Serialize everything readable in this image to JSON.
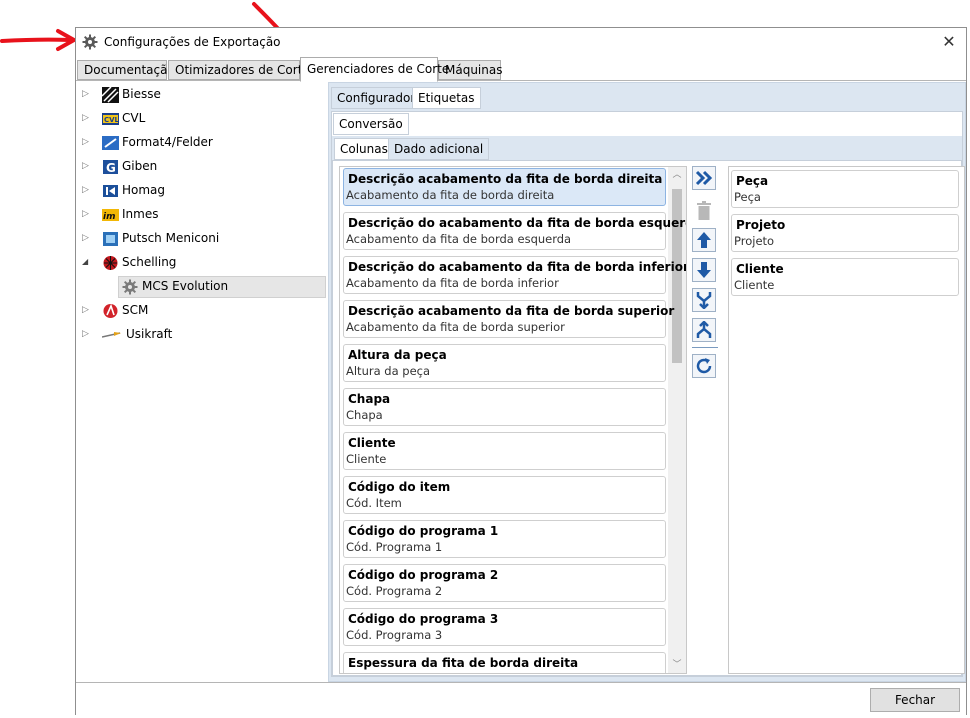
{
  "window": {
    "title": "Configurações de Exportação",
    "close_glyph": "✕",
    "icon": "gear-icon"
  },
  "main_tabs": [
    {
      "label": "Documentação",
      "active": false
    },
    {
      "label": "Otimizadores de Corte",
      "active": false
    },
    {
      "label": "Gerenciadores de Corte",
      "active": true
    },
    {
      "label": "Máquinas",
      "active": false
    }
  ],
  "tree": {
    "items": [
      {
        "label": "Biesse",
        "icon": "biesse-logo-icon",
        "expander": "▷"
      },
      {
        "label": "CVL",
        "icon": "cvl-logo-icon",
        "expander": "▷"
      },
      {
        "label": "Format4/Felder",
        "icon": "format4-logo-icon",
        "expander": "▷"
      },
      {
        "label": "Giben",
        "icon": "giben-logo-icon",
        "expander": "▷"
      },
      {
        "label": "Homag",
        "icon": "homag-logo-icon",
        "expander": "▷"
      },
      {
        "label": "Inmes",
        "icon": "inmes-logo-icon",
        "expander": "▷"
      },
      {
        "label": "Putsch Meniconi",
        "icon": "putsch-logo-icon",
        "expander": "▷"
      },
      {
        "label": "Schelling",
        "icon": "schelling-logo-icon",
        "expander": "◢"
      },
      {
        "label": "MCS Evolution",
        "icon": "gear-icon",
        "expander": ""
      },
      {
        "label": "SCM",
        "icon": "scm-logo-icon",
        "expander": "▷"
      },
      {
        "label": "Usikraft",
        "icon": "usikraft-logo-icon",
        "expander": "▷"
      }
    ]
  },
  "sub_tabs": {
    "level1": [
      {
        "label": "Configurador",
        "active": false
      },
      {
        "label": "Etiquetas",
        "active": true
      }
    ],
    "level2": [
      {
        "label": "Conversão",
        "active": true
      }
    ],
    "level3": [
      {
        "label": "Colunas",
        "active": true
      },
      {
        "label": "Dado adicional",
        "active": false
      }
    ]
  },
  "available_columns": [
    {
      "title": "Descrição acabamento da fita de borda direita",
      "sub": "Acabamento da fita de borda direita"
    },
    {
      "title": "Descrição do acabamento da fita de borda esquerda",
      "sub": "Acabamento da fita de borda esquerda"
    },
    {
      "title": "Descrição do acabamento da fita de borda inferior",
      "sub": "Acabamento da fita de borda inferior"
    },
    {
      "title": "Descrição acabamento da fita de borda superior",
      "sub": "Acabamento da fita de borda superior"
    },
    {
      "title": "Altura da peça",
      "sub": "Altura da peça"
    },
    {
      "title": "Chapa",
      "sub": "Chapa"
    },
    {
      "title": "Cliente",
      "sub": "Cliente"
    },
    {
      "title": "Código do item",
      "sub": "Cód. Item"
    },
    {
      "title": "Código do programa 1",
      "sub": "Cód. Programa 1"
    },
    {
      "title": "Código do programa 2",
      "sub": "Cód. Programa 2"
    },
    {
      "title": "Código do programa 3",
      "sub": "Cód. Programa 3"
    },
    {
      "title": "Espessura da fita de borda direita",
      "sub": ""
    }
  ],
  "selected_columns": [
    {
      "title": "Peça",
      "sub": "Peça"
    },
    {
      "title": "Projeto",
      "sub": "Projeto"
    },
    {
      "title": "Cliente",
      "sub": "Cliente"
    }
  ],
  "toolbar": {
    "buttons": [
      "add-all-icon",
      "delete-icon",
      "move-up-icon",
      "move-down-icon",
      "merge-icon",
      "split-icon",
      "refresh-icon"
    ]
  },
  "colors": {
    "panel_bg": "#dce6f1",
    "selection_bg": "#dbe8f7",
    "toolbar_blue": "#1f5aa6",
    "arrow_red": "#e8121b"
  },
  "footer": {
    "close_label": "Fechar"
  }
}
